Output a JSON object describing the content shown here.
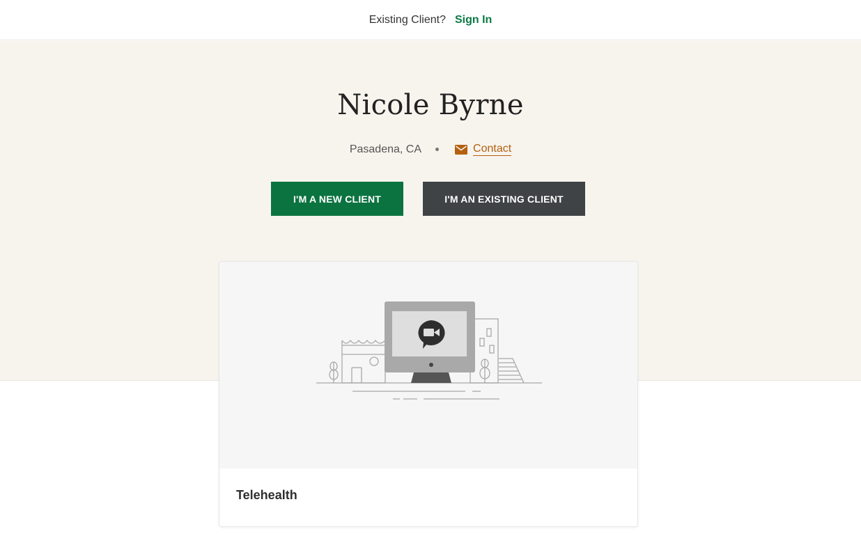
{
  "topbar": {
    "question": "Existing Client?",
    "signin_label": "Sign In",
    "accent": "#0b7a43"
  },
  "profile": {
    "name": "Nicole Byrne",
    "location": "Pasadena, CA",
    "contact_label": "Contact",
    "contact_icon": "mail-icon",
    "contact_color": "#b4600f"
  },
  "actions": {
    "new_client_label": "I'M A NEW CLIENT",
    "existing_client_label": "I'M AN EXISTING CLIENT",
    "new_client_color": "#0b7340",
    "existing_client_color": "#3f4346"
  },
  "service_card": {
    "title": "Telehealth",
    "illustration_icon": "telehealth-illustration"
  }
}
